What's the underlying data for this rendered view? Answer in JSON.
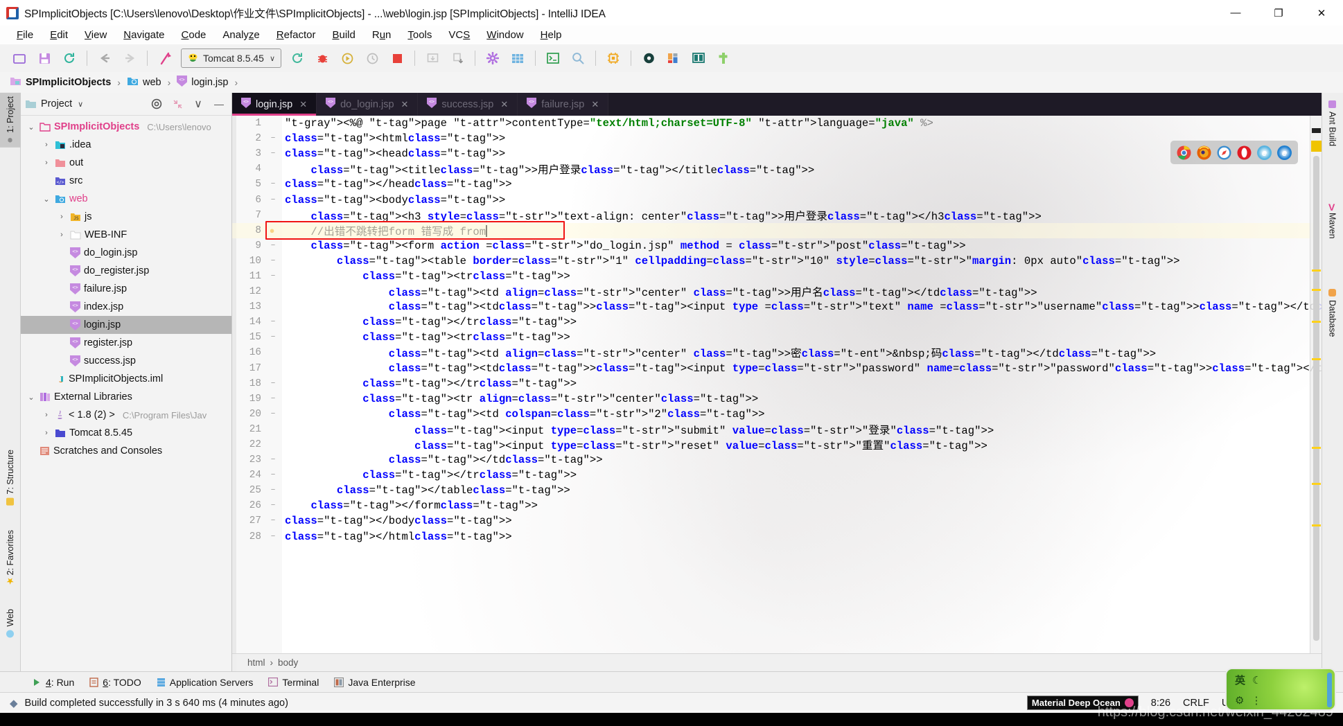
{
  "window": {
    "title": "SPImplicitObjects [C:\\Users\\lenovo\\Desktop\\作业文件\\SPImplicitObjects] - ...\\web\\login.jsp [SPImplicitObjects] - IntelliJ IDEA",
    "app_icon": "intellij-idea-icon",
    "minimize": "—",
    "maximize": "❐",
    "close": "✕"
  },
  "menu": [
    {
      "label": "File",
      "mnemonic": "F"
    },
    {
      "label": "Edit",
      "mnemonic": "E"
    },
    {
      "label": "View",
      "mnemonic": "V"
    },
    {
      "label": "Navigate",
      "mnemonic": "N"
    },
    {
      "label": "Code",
      "mnemonic": "C"
    },
    {
      "label": "Analyze",
      "mnemonic": "z"
    },
    {
      "label": "Refactor",
      "mnemonic": "R"
    },
    {
      "label": "Build",
      "mnemonic": "B"
    },
    {
      "label": "Run",
      "mnemonic": "u"
    },
    {
      "label": "Tools",
      "mnemonic": "T"
    },
    {
      "label": "VCS",
      "mnemonic": "S"
    },
    {
      "label": "Window",
      "mnemonic": "W"
    },
    {
      "label": "Help",
      "mnemonic": "H"
    }
  ],
  "toolbar": {
    "run_config": "Tomcat 8.5.45",
    "run_config_icon": "tomcat-icon",
    "caret": "∨",
    "icons": [
      "open-project-icon",
      "save-all-icon",
      "sync-icon",
      "back-icon",
      "forward-icon",
      "run-anything-icon"
    ],
    "icons_right": [
      "rerun-icon",
      "debug-icon",
      "run-coverage-icon",
      "profile-icon",
      "stop-icon",
      "update-app-icon",
      "deploy-icon",
      "settings-icon",
      "project-structure-icon",
      "terminal-icon",
      "search-everywhere-icon",
      "ide-scripting-icon",
      "database-icon",
      "rest-client-icon",
      "persistence-icon",
      "ant-build-icon"
    ]
  },
  "navbar": {
    "crumbs": [
      {
        "label": "SPImplicitObjects",
        "icon": "module-icon"
      },
      {
        "label": "web",
        "icon": "web-folder-icon"
      },
      {
        "label": "login.jsp",
        "icon": "jsp-file-icon"
      }
    ],
    "separator": "›"
  },
  "left_strip": [
    {
      "label": "1: Project",
      "icon": "project-icon",
      "selected": true
    },
    {
      "label": "7: Structure",
      "icon": "structure-icon",
      "selected": false
    },
    {
      "label": "2: Favorites",
      "icon": "favorites-star-icon",
      "selected": false
    },
    {
      "label": "Web",
      "icon": "web-icon",
      "selected": false
    }
  ],
  "right_strip": [
    {
      "label": "Ant Build",
      "icon": "ant-icon"
    },
    {
      "label": "Maven",
      "icon": "maven-icon"
    },
    {
      "label": "Database",
      "icon": "database-icon"
    }
  ],
  "project_panel": {
    "title": "Project",
    "caret": "∨",
    "buttons": [
      "locate-icon",
      "collapse-all-icon",
      "options-icon",
      "hide-icon"
    ],
    "tree": [
      {
        "indent": 0,
        "arrow": "⌄",
        "icon": "project-root-icon",
        "label": "SPImplicitObjects",
        "style": "pink-bold",
        "path": "C:\\Users\\lenovo",
        "selected": false
      },
      {
        "indent": 1,
        "arrow": "›",
        "icon": "idea-folder-icon",
        "label": ".idea",
        "style": "normal",
        "path": "",
        "selected": false
      },
      {
        "indent": 1,
        "arrow": "›",
        "icon": "out-folder-icon",
        "label": "out",
        "style": "normal",
        "path": "",
        "selected": false
      },
      {
        "indent": 1,
        "arrow": "",
        "icon": "src-folder-icon",
        "label": "src",
        "style": "normal",
        "path": "",
        "selected": false
      },
      {
        "indent": 1,
        "arrow": "⌄",
        "icon": "web-folder-icon",
        "label": "web",
        "style": "pink",
        "path": "",
        "selected": false
      },
      {
        "indent": 2,
        "arrow": "›",
        "icon": "js-folder-icon",
        "label": "js",
        "style": "normal",
        "path": "",
        "selected": false
      },
      {
        "indent": 2,
        "arrow": "›",
        "icon": "webinf-folder-icon",
        "label": "WEB-INF",
        "style": "normal",
        "path": "",
        "selected": false
      },
      {
        "indent": 2,
        "arrow": "",
        "icon": "jsp-file-icon",
        "label": "do_login.jsp",
        "style": "normal",
        "path": "",
        "selected": false
      },
      {
        "indent": 2,
        "arrow": "",
        "icon": "jsp-file-icon",
        "label": "do_register.jsp",
        "style": "normal",
        "path": "",
        "selected": false
      },
      {
        "indent": 2,
        "arrow": "",
        "icon": "jsp-file-icon",
        "label": "failure.jsp",
        "style": "normal",
        "path": "",
        "selected": false
      },
      {
        "indent": 2,
        "arrow": "",
        "icon": "jsp-file-icon",
        "label": "index.jsp",
        "style": "normal",
        "path": "",
        "selected": false
      },
      {
        "indent": 2,
        "arrow": "",
        "icon": "jsp-file-icon",
        "label": "login.jsp",
        "style": "normal",
        "path": "",
        "selected": true
      },
      {
        "indent": 2,
        "arrow": "",
        "icon": "jsp-file-icon",
        "label": "register.jsp",
        "style": "normal",
        "path": "",
        "selected": false
      },
      {
        "indent": 2,
        "arrow": "",
        "icon": "jsp-file-icon",
        "label": "success.jsp",
        "style": "normal",
        "path": "",
        "selected": false
      },
      {
        "indent": 1,
        "arrow": "",
        "icon": "iml-file-icon",
        "label": "SPImplicitObjects.iml",
        "style": "normal",
        "path": "",
        "selected": false
      },
      {
        "indent": 0,
        "arrow": "⌄",
        "icon": "external-libraries-icon",
        "label": "External Libraries",
        "style": "normal",
        "path": "",
        "selected": false
      },
      {
        "indent": 1,
        "arrow": "›",
        "icon": "java-sdk-icon",
        "label": "< 1.8 (2) >",
        "style": "normal",
        "path": "C:\\Program Files\\Jav",
        "selected": false
      },
      {
        "indent": 1,
        "arrow": "›",
        "icon": "library-folder-icon",
        "label": "Tomcat 8.5.45",
        "style": "normal",
        "path": "",
        "selected": false
      },
      {
        "indent": 0,
        "arrow": "",
        "icon": "scratches-icon",
        "label": "Scratches and Consoles",
        "style": "normal",
        "path": "",
        "selected": false
      }
    ]
  },
  "editor": {
    "tabs": [
      {
        "label": "login.jsp",
        "icon": "jsp-file-icon",
        "close": "✕",
        "active": true
      },
      {
        "label": "do_login.jsp",
        "icon": "jsp-file-icon",
        "close": "✕",
        "active": false
      },
      {
        "label": "success.jsp",
        "icon": "jsp-file-icon",
        "close": "✕",
        "active": false
      },
      {
        "label": "failure.jsp",
        "icon": "jsp-file-icon",
        "close": "✕",
        "active": false
      }
    ],
    "browsers": [
      {
        "name": "chrome-icon",
        "glyph": "",
        "color": "#4285f4"
      },
      {
        "name": "firefox-icon",
        "glyph": "",
        "color": "#e66000"
      },
      {
        "name": "safari-icon",
        "glyph": "",
        "color": "#3b8ed0"
      },
      {
        "name": "opera-icon",
        "glyph": "O",
        "color": "#e01b24"
      },
      {
        "name": "internet-explorer-icon",
        "glyph": "e",
        "color": "#57b3e0"
      },
      {
        "name": "edge-icon",
        "glyph": "e",
        "color": "#1f7fd0"
      }
    ],
    "current_line": 8,
    "intention_bulb": "💡",
    "caret_visible": true,
    "breadcrumb": [
      "html",
      "body"
    ],
    "breadcrumb_sep": "›",
    "lines": [
      {
        "n": 1,
        "fold": ""
      },
      {
        "n": 2,
        "fold": "−"
      },
      {
        "n": 3,
        "fold": "−"
      },
      {
        "n": 4,
        "fold": ""
      },
      {
        "n": 5,
        "fold": "−"
      },
      {
        "n": 6,
        "fold": "−"
      },
      {
        "n": 7,
        "fold": ""
      },
      {
        "n": 8,
        "fold": ""
      },
      {
        "n": 9,
        "fold": "−"
      },
      {
        "n": 10,
        "fold": "−"
      },
      {
        "n": 11,
        "fold": "−"
      },
      {
        "n": 12,
        "fold": ""
      },
      {
        "n": 13,
        "fold": ""
      },
      {
        "n": 14,
        "fold": "−"
      },
      {
        "n": 15,
        "fold": "−"
      },
      {
        "n": 16,
        "fold": ""
      },
      {
        "n": 17,
        "fold": ""
      },
      {
        "n": 18,
        "fold": "−"
      },
      {
        "n": 19,
        "fold": "−"
      },
      {
        "n": 20,
        "fold": "−"
      },
      {
        "n": 21,
        "fold": ""
      },
      {
        "n": 22,
        "fold": ""
      },
      {
        "n": 23,
        "fold": "−"
      },
      {
        "n": 24,
        "fold": "−"
      },
      {
        "n": 25,
        "fold": "−"
      },
      {
        "n": 26,
        "fold": "−"
      },
      {
        "n": 27,
        "fold": "−"
      },
      {
        "n": 28,
        "fold": "−"
      }
    ],
    "source_text": [
      "<%@ page contentType=\"text/html;charset=UTF-8\" language=\"java\" %>",
      "<html>",
      "<head>",
      "    <title>用户登录</title>",
      "</head>",
      "<body>",
      "    <h3 style=\"text-align: center\">用户登录</h3>",
      "    //出错不跳转把form 错写成 from",
      "    <form action =\"do_login.jsp\" method = \"post\">",
      "        <table border=\"1\" cellpadding=\"10\" style=\"margin: 0px auto\">",
      "            <tr>",
      "                <td align=\"center\" >用户名</td>",
      "                <td><input type =\"text\" name =\"username\"></td>",
      "            </tr>",
      "            <tr>",
      "                <td align=\"center\" >密&nbsp;码</td>",
      "                <td><input type=\"password\" name=\"password\"></td>",
      "            </tr>",
      "            <tr align=\"center\">",
      "                <td colspan=\"2\">",
      "                    <input type=\"submit\" value=\"登录\">",
      "                    <input type=\"reset\" value=\"重置\">",
      "                </td>",
      "            </tr>",
      "        </table>",
      "    </form>",
      "</body>",
      "</html>"
    ]
  },
  "bottom_tools": [
    {
      "label": "4: Run",
      "mnemonic": "4",
      "icon": "run-icon"
    },
    {
      "label": "6: TODO",
      "mnemonic": "6",
      "icon": "todo-icon"
    },
    {
      "label": "Application Servers",
      "mnemonic": "",
      "icon": "app-servers-icon"
    },
    {
      "label": "Terminal",
      "mnemonic": "",
      "icon": "terminal-icon"
    },
    {
      "label": "Java Enterprise",
      "mnemonic": "",
      "icon": "java-enterprise-icon"
    }
  ],
  "status": {
    "message": "Build completed successfully in 3 s 640 ms (4 minutes ago)",
    "message_icon": "build-icon",
    "theme": "Material Deep Ocean",
    "caret_position": "8:26",
    "line_separator": "CRLF",
    "encoding": "UTF-8"
  },
  "watermark": "https://blog.csdn.net/weixin_44202489",
  "ime": {
    "mode": "英",
    "moon": "☾",
    "gear": "⚙",
    "dots": "⋮"
  },
  "colors": {
    "accent_pink": "#e0408a",
    "tab_dark": "#13101a",
    "tag": "#000080",
    "attr": "#0000ff",
    "string": "#008000",
    "highlight": "#ede0a1",
    "error_box": "#f01414"
  }
}
